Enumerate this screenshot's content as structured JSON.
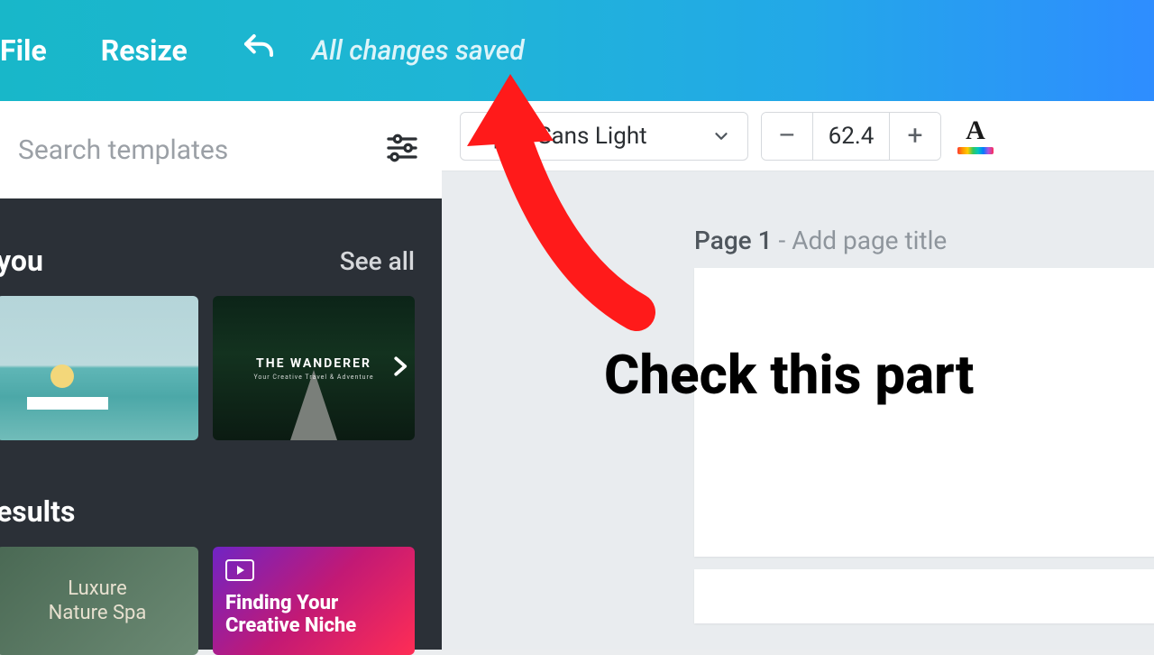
{
  "topbar": {
    "file_label": "File",
    "resize_label": "Resize",
    "saved_status": "All changes saved"
  },
  "sidebar": {
    "search_placeholder": "Search templates",
    "section_for_you": "you",
    "see_all": "See all",
    "section_results": "esults",
    "thumbs": {
      "wanderer_title": "THE WANDERER",
      "wanderer_sub": "Your Creative Travel & Adventure",
      "spa_line1": "Luxure",
      "spa_line2": "Nature Spa",
      "niche_text": "Finding Your Creative Niche"
    }
  },
  "toolbar": {
    "font_name": "Open Sans Light",
    "font_size": "62.4"
  },
  "page": {
    "label_num": "Page 1",
    "label_hint": " - Add page title"
  },
  "annotation": {
    "text": "Check this part"
  }
}
